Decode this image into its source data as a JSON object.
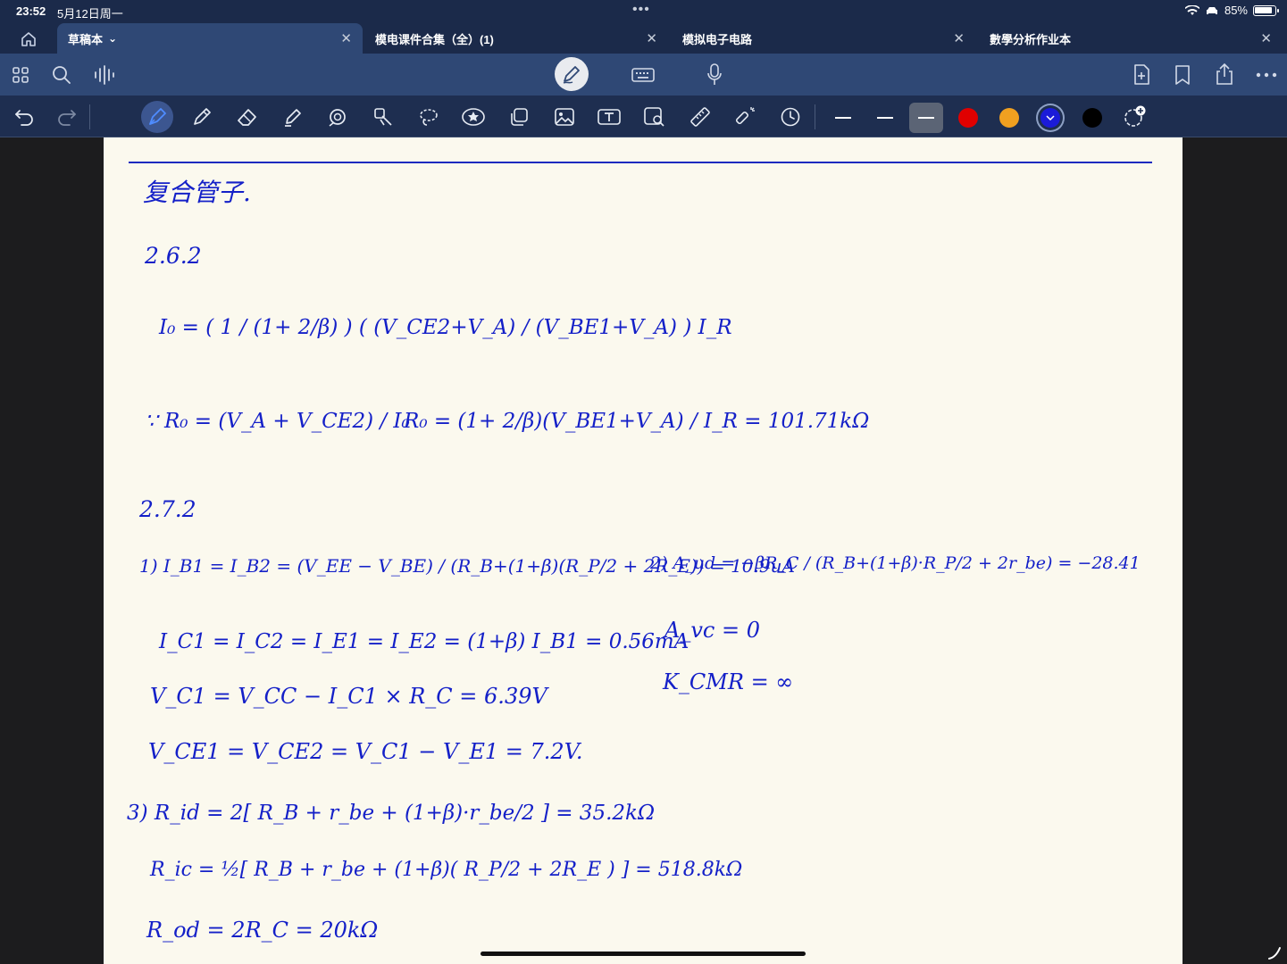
{
  "status": {
    "time": "23:52",
    "date": "5月12日周一",
    "battery": "85%",
    "battery_level": 0.85
  },
  "tabs": [
    {
      "label": "草稿本",
      "chevron": "⌄",
      "active": true
    },
    {
      "label": "模电课件合集（全）(1)",
      "active": false
    },
    {
      "label": "模拟电子电路",
      "active": false
    },
    {
      "label": "數學分析作业本",
      "active": false
    }
  ],
  "icons": {
    "home": "home-icon",
    "grid": "grid-icon",
    "search": "search-icon",
    "audio": "audio-wave-icon",
    "pen_mode": "pen-mode-icon",
    "keyboard": "keyboard-icon",
    "mic": "microphone-icon",
    "add_page": "add-page-icon",
    "bookmark": "bookmark-icon",
    "share": "share-icon",
    "more": "more-icon"
  },
  "colors": {
    "ink": "#1420c8",
    "paper": "#fbf9ee",
    "swatches": [
      "#e00000",
      "#f0a020",
      "#1b1bd8",
      "#000000"
    ]
  },
  "note": {
    "heading": "复合管子.",
    "s1_num": "2.6.2",
    "eq_io": "I₀ = ( 1 / (1+ 2/β) ) ( (V_CE2+V_A) / (V_BE1+V_A) ) I_R",
    "eq_ro1": "∵ R₀ = (V_A + V_CE2) / I₀",
    "eq_ro2": "R₀ = (1+ 2/β)(V_BE1+V_A) / I_R = 101.71kΩ",
    "s2_num": "2.7.2",
    "eq_ib": "1)  I_B1 = I_B2 = (V_EE − V_BE) / (R_B+(1+β)(R_P/2 + 2R_E)) = 10.9uA",
    "eq_ic": "I_C1 = I_C2 = I_E1 = I_E2 = (1+β) I_B1 = 0.56mA",
    "eq_vc1": "V_C1 = V_CC − I_C1 × R_C = 6.39V",
    "eq_vce": "V_CE1 = V_CE2 = V_C1 − V_E1 = 7.2V.",
    "eq_aud": "2)  A_ud = −βR_C / (R_B+(1+β)·R_P/2 + 2r_be) = −28.41",
    "eq_avc": "A_vc = 0",
    "eq_kcmr": "K_CMR = ∞",
    "eq_rid": "3)  R_id = 2[ R_B + r_be + (1+β)·r_be/2 ] = 35.2kΩ",
    "eq_ric": "R_ic = ½[ R_B + r_be + (1+β)( R_P/2 + 2R_E ) ] = 518.8kΩ",
    "eq_rod": "R_od = 2R_C = 20kΩ"
  }
}
